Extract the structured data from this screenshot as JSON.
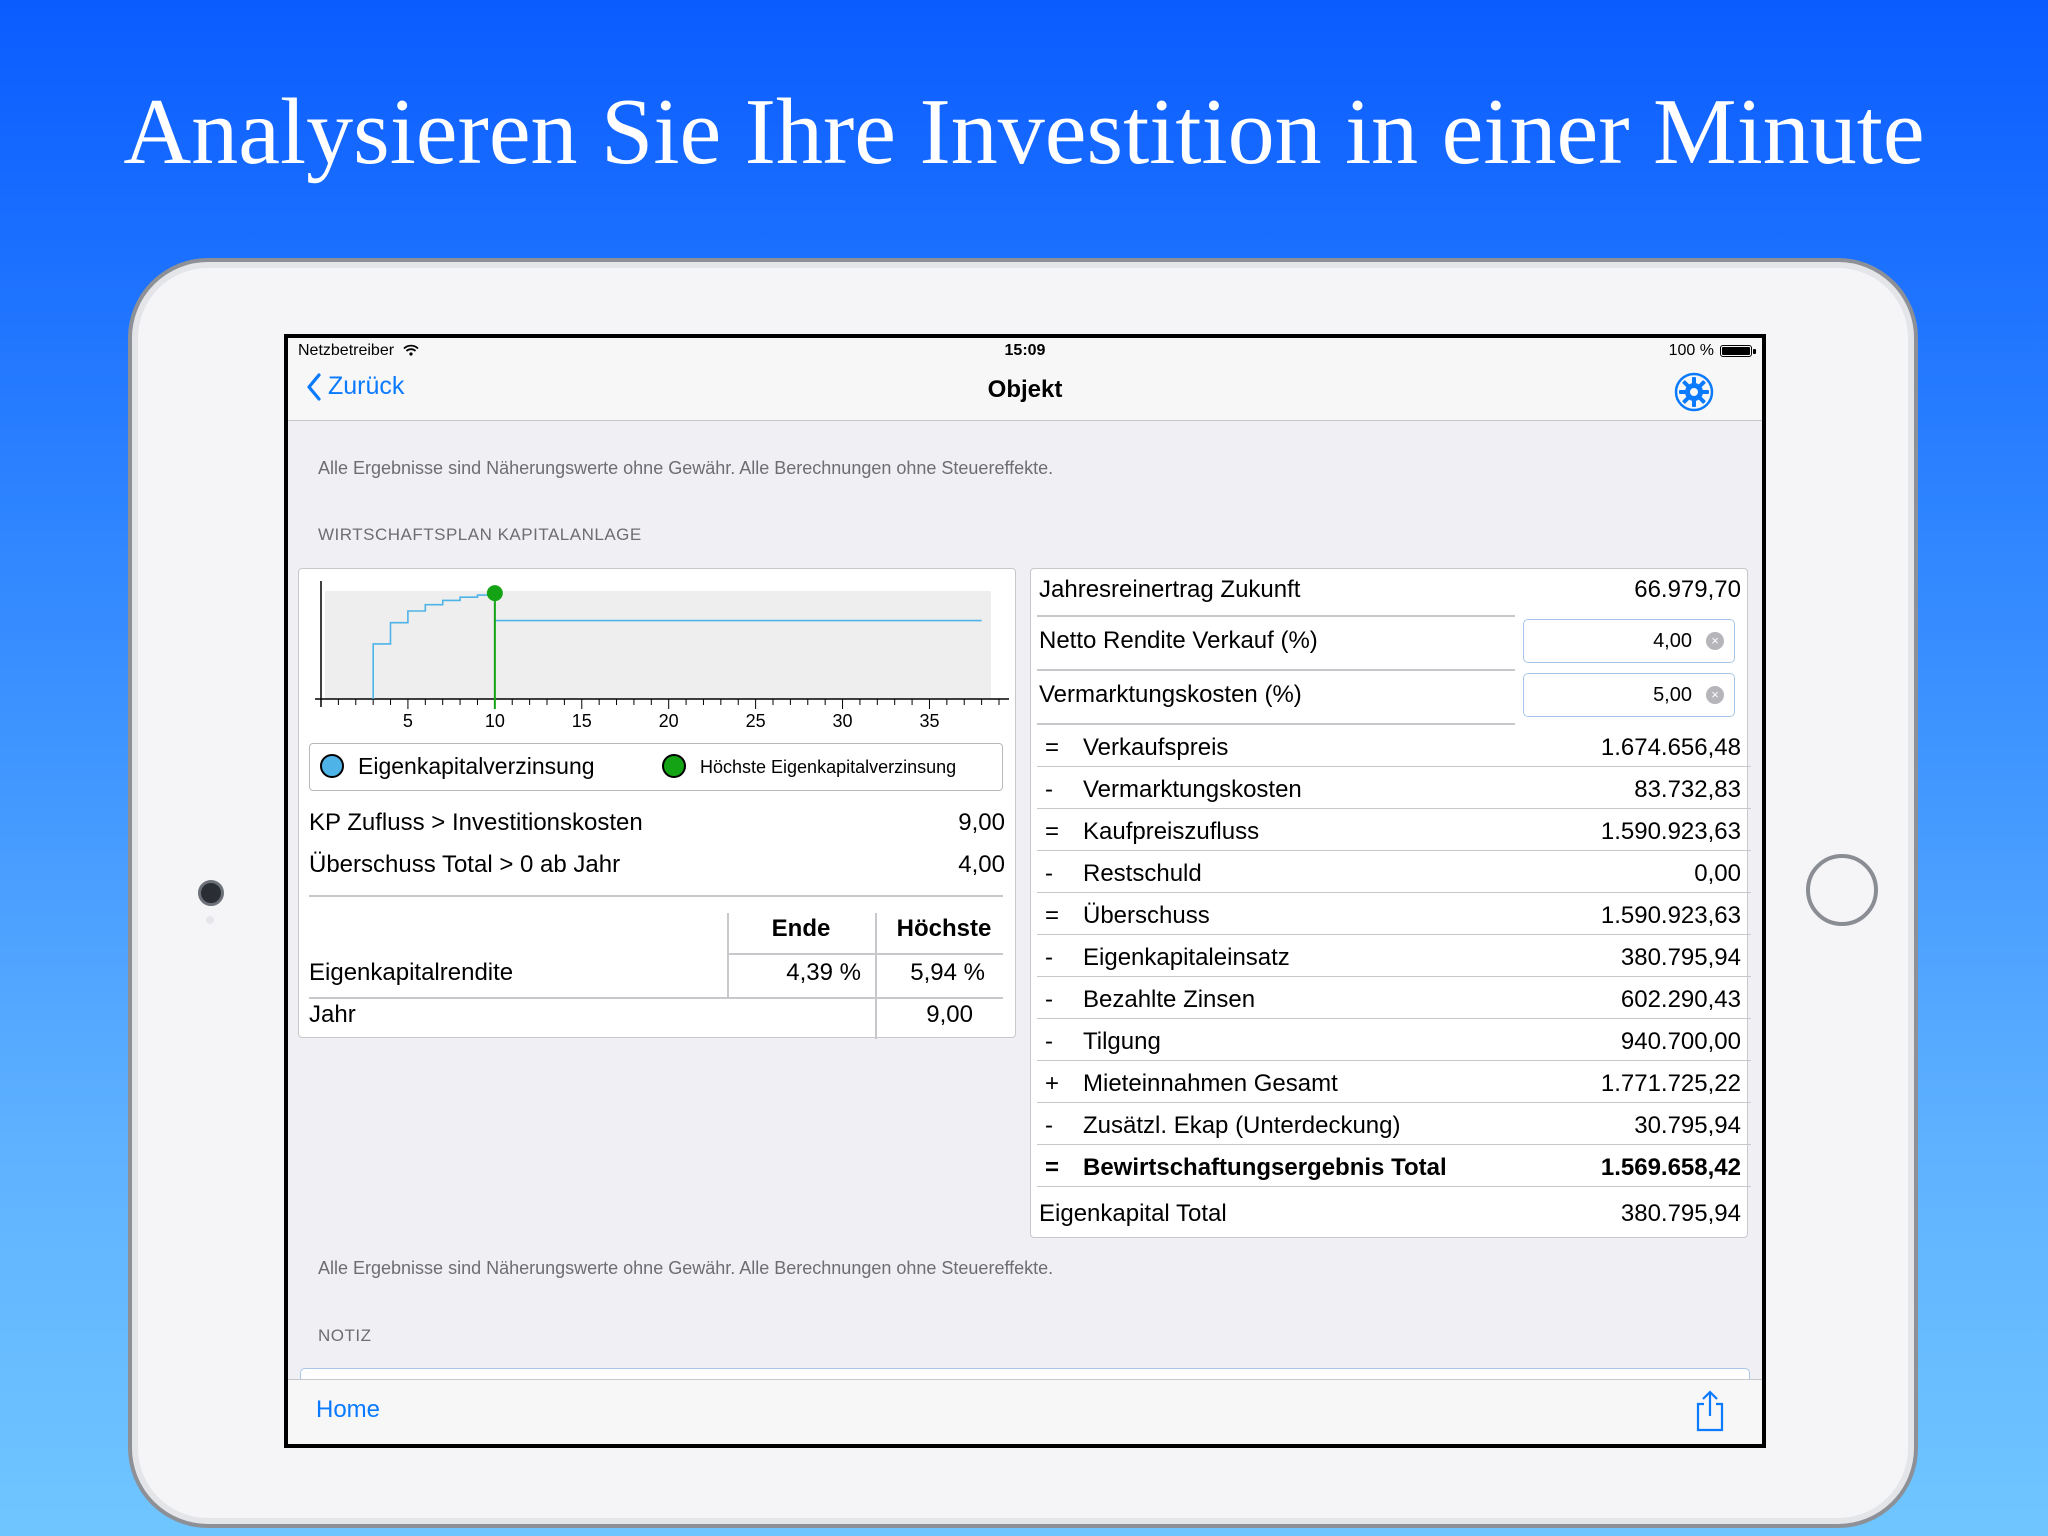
{
  "headline": "Analysieren Sie Ihre Investition in einer Minute",
  "status": {
    "carrier": "Netzbetreiber",
    "time": "15:09",
    "battery": "100 %"
  },
  "nav": {
    "back_label": "Zurück",
    "title": "Objekt"
  },
  "disclaimer": "Alle Ergebnisse sind Näherungswerte ohne Gewähr. Alle Berechnungen ohne Steuereffekte.",
  "section_title": "WIRTSCHAFTSPLAN KAPITALANLAGE",
  "chart_data": {
    "type": "line",
    "x_ticks": [
      "5",
      "10",
      "15",
      "20",
      "25",
      "30",
      "35"
    ],
    "xlim": [
      0,
      39
    ],
    "highlight_x": 10,
    "series": [
      {
        "name": "Eigenkapitalverzinsung",
        "x": [
          3.0,
          3.0,
          4.0,
          4.0,
          5.0,
          5.0,
          6.0,
          6.0,
          7.0,
          7.0,
          8.0,
          8.0,
          9.0,
          9.0,
          10.0,
          10.0,
          38.0
        ],
        "y": [
          0,
          0.52,
          0.52,
          0.72,
          0.72,
          0.83,
          0.83,
          0.89,
          0.89,
          0.93,
          0.93,
          0.96,
          0.96,
          0.98,
          0.98,
          0.74,
          0.74
        ]
      }
    ],
    "legend": [
      "Eigenkapitalverzinsung",
      "Höchste Eigenkapitalverzinsung"
    ],
    "colors": {
      "series": "#4eb3e7",
      "highlight": "#13a314",
      "grid": "#eeeeee"
    }
  },
  "left": {
    "legend_series": "Eigenkapitalverzinsung",
    "legend_highlight": "Höchste Eigenkapitalverzinsung",
    "kp_label": "KP Zufluss > Investitionskosten",
    "kp_value": "9,00",
    "ueberschuss_label": "Überschuss Total > 0 ab Jahr",
    "ueberschuss_value": "4,00",
    "table": {
      "col_end": "Ende",
      "col_max": "Höchste",
      "row1_label": "Eigenkapitalrendite",
      "row1_end": "4,39 %",
      "row1_max": "5,94 %",
      "row2_label": "Jahr",
      "row2_max": "9,00"
    }
  },
  "right": {
    "jahres_label": "Jahresreinertrag Zukunft",
    "jahres_value": "66.979,70",
    "netto_label": "Netto Rendite Verkauf (%)",
    "netto_value": "4,00",
    "vermarkt_label": "Vermarktungskosten (%)",
    "vermarkt_value": "5,00",
    "rows": [
      {
        "op": "=",
        "label": "Verkaufspreis",
        "value": "1.674.656,48"
      },
      {
        "op": "-",
        "label": "Vermarktungskosten",
        "value": "83.732,83"
      },
      {
        "op": "=",
        "label": "Kaufpreiszufluss",
        "value": "1.590.923,63"
      },
      {
        "op": "-",
        "label": "Restschuld",
        "value": "0,00"
      },
      {
        "op": "=",
        "label": "Überschuss",
        "value": "1.590.923,63"
      },
      {
        "op": "-",
        "label": "Eigenkapitaleinsatz",
        "value": "380.795,94"
      },
      {
        "op": "-",
        "label": "Bezahlte Zinsen",
        "value": "602.290,43"
      },
      {
        "op": "-",
        "label": "Tilgung",
        "value": "940.700,00"
      },
      {
        "op": "+",
        "label": "Mieteinnahmen Gesamt",
        "value": "1.771.725,22"
      },
      {
        "op": "-",
        "label": "Zusätzl. Ekap (Unterdeckung)",
        "value": "30.795,94"
      },
      {
        "op": "=",
        "label": "Bewirtschaftungsergebnis Total",
        "value": "1.569.658,42"
      }
    ],
    "total_label": "Eigenkapital Total",
    "total_value": "380.795,94"
  },
  "note_section": "NOTIZ",
  "toolbar": {
    "home_label": "Home"
  },
  "colors": {
    "accent": "#0a7aff",
    "background_top": "#0a5cff",
    "background_bottom": "#6fc6ff"
  },
  "icons": {
    "back": "chevron-left-icon",
    "settings": "gear-icon",
    "share": "share-icon",
    "wifi": "wifi-icon",
    "battery": "battery-icon",
    "clear": "clear-icon"
  }
}
